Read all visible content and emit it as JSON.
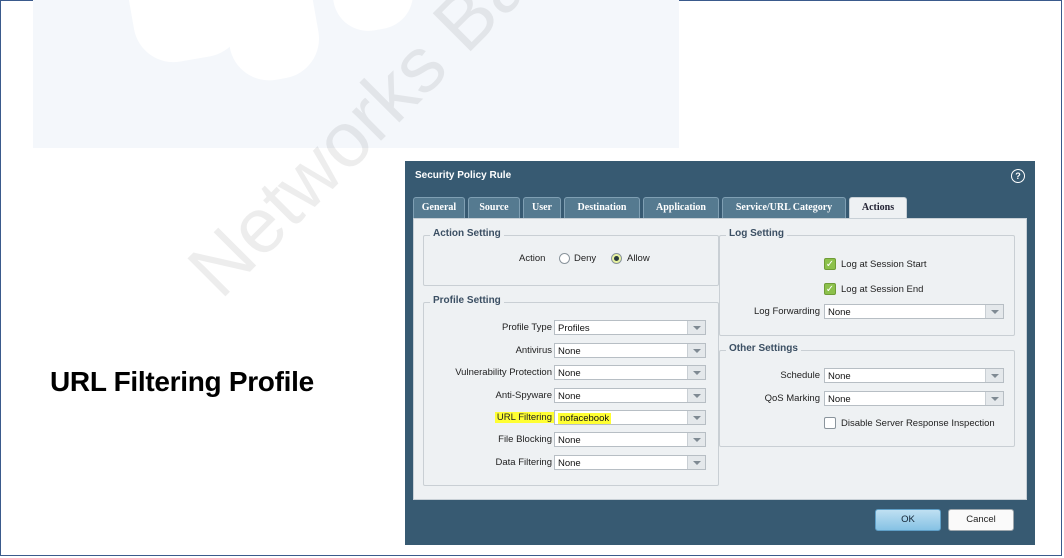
{
  "slide": {
    "title": "URL Filtering Profile",
    "watermark": "Networks Baseline Pro"
  },
  "dialog": {
    "title": "Security Policy Rule",
    "help_icon": "?",
    "tabs": [
      {
        "label": "General",
        "active": false
      },
      {
        "label": "Source",
        "active": false
      },
      {
        "label": "User",
        "active": false
      },
      {
        "label": "Destination",
        "active": false
      },
      {
        "label": "Application",
        "active": false
      },
      {
        "label": "Service/URL Category",
        "active": false
      },
      {
        "label": "Actions",
        "active": true
      }
    ],
    "action_setting": {
      "legend": "Action Setting",
      "action_label": "Action",
      "deny_label": "Deny",
      "allow_label": "Allow",
      "selected": "Allow"
    },
    "profile_setting": {
      "legend": "Profile Setting",
      "rows": [
        {
          "label": "Profile Type",
          "value": "Profiles"
        },
        {
          "label": "Antivirus",
          "value": "None"
        },
        {
          "label": "Vulnerability Protection",
          "value": "None"
        },
        {
          "label": "Anti-Spyware",
          "value": "None"
        },
        {
          "label": "URL Filtering",
          "value": "nofacebook"
        },
        {
          "label": "File Blocking",
          "value": "None"
        },
        {
          "label": "Data Filtering",
          "value": "None"
        }
      ]
    },
    "log_setting": {
      "legend": "Log Setting",
      "log_start_label": "Log at Session Start",
      "log_start_checked": true,
      "log_end_label": "Log at Session End",
      "log_end_checked": true,
      "log_forwarding_label": "Log Forwarding",
      "log_forwarding_value": "None"
    },
    "other_settings": {
      "legend": "Other Settings",
      "schedule_label": "Schedule",
      "schedule_value": "None",
      "qos_label": "QoS Marking",
      "qos_value": "None",
      "disable_sri_label": "Disable Server Response Inspection",
      "disable_sri_checked": false
    },
    "ok_label": "OK",
    "cancel_label": "Cancel"
  },
  "colors": {
    "dialog_bg": "#375a72",
    "highlight": "#ffff33",
    "checkbox_on": "#8cc14b"
  }
}
